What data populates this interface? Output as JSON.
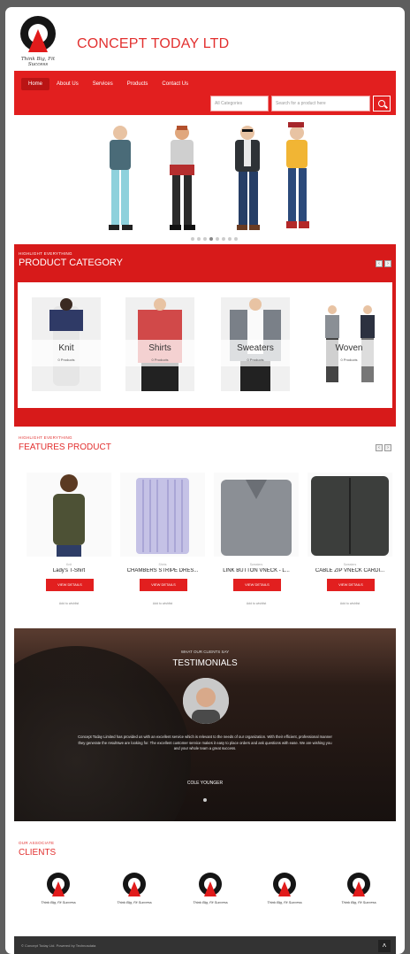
{
  "brand": {
    "name": "CONCEPT TODAY LTD",
    "tagline": "Think Big, Fit Success"
  },
  "nav": {
    "items": [
      "Home",
      "About Us",
      "Services",
      "Products",
      "Contact Us"
    ],
    "active": 0
  },
  "search": {
    "category_placeholder": "All Categories",
    "input_placeholder": "Search for a product here"
  },
  "hero": {
    "slides": 8,
    "active_slide": 3
  },
  "category_section": {
    "kicker": "HIGHLIGHT EVERYTHING",
    "title": "PRODUCT CATEGORY",
    "items": [
      {
        "label": "Knit",
        "count": "0 Products"
      },
      {
        "label": "Shirts",
        "count": "0 Products"
      },
      {
        "label": "Sweaters",
        "count": "0 Products"
      },
      {
        "label": "Woven",
        "count": "0 Products"
      }
    ]
  },
  "features_section": {
    "kicker": "HIGHLIGHT EVERYTHING",
    "title": "FEATURES PRODUCT",
    "products": [
      {
        "category": "Knit",
        "name": "Lady's T-Shirt",
        "button": "VIEW DETAILS",
        "wishlist": "Add to wishlist"
      },
      {
        "category": "Shirts",
        "name": "CHAMBERS STRIPE DRES...",
        "button": "VIEW DETAILS",
        "wishlist": "Add to wishlist"
      },
      {
        "category": "Sweaters",
        "name": "LINK BUTTON VNECK - L...",
        "button": "VIEW DETAILS",
        "wishlist": "Add to wishlist"
      },
      {
        "category": "Sweaters",
        "name": "CABLE ZIP VNECK CARDI...",
        "button": "VIEW DETAILS",
        "wishlist": "Add to wishlist"
      }
    ]
  },
  "testimonials": {
    "kicker": "WHAT OUR CLIENTS SAY",
    "title": "TESTIMONIALS",
    "quote": "Concept Today Limited has provided us with an excellent service which is relevant to the needs of our organization. With their efficient, professional manner they generate the resultswe are looking for. The excellent customer service makes it easy to place orders and ask questions with ease. We are wishing you and your whole team a great success.",
    "author": "COLE YOUNGER"
  },
  "clients_section": {
    "kicker": "OUR ASSOCIATE",
    "title": "CLIENTS",
    "count": 5
  },
  "footer": {
    "copyright": "© Concept Today Ltd. Powered by Technosdata"
  },
  "colors": {
    "accent": "#e21f1f",
    "brand_text": "#e2302f",
    "footer": "#333333"
  }
}
